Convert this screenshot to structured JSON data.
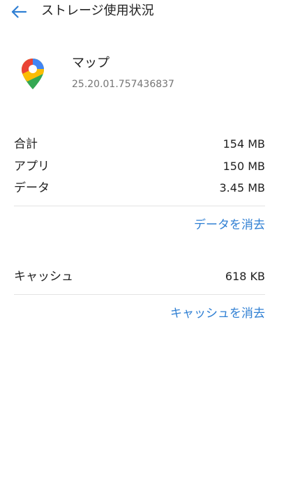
{
  "toolbar": {
    "back_icon": "arrow-back-icon",
    "title": "ストレージ使用状況"
  },
  "app": {
    "icon": "google-maps-icon",
    "name": "マップ",
    "version": "25.20.01.757436837"
  },
  "storage": {
    "total_label": "合計",
    "total_value": "154 MB",
    "app_label": "アプリ",
    "app_value": "150 MB",
    "data_label": "データ",
    "data_value": "3.45 MB",
    "clear_data_label": "データを消去"
  },
  "cache": {
    "label": "キャッシュ",
    "value": "618 KB",
    "clear_cache_label": "キャッシュを消去"
  },
  "colors": {
    "accent": "#2f7fd3",
    "text_primary": "#212121",
    "text_secondary": "#757575",
    "divider": "#e3e3e3"
  }
}
